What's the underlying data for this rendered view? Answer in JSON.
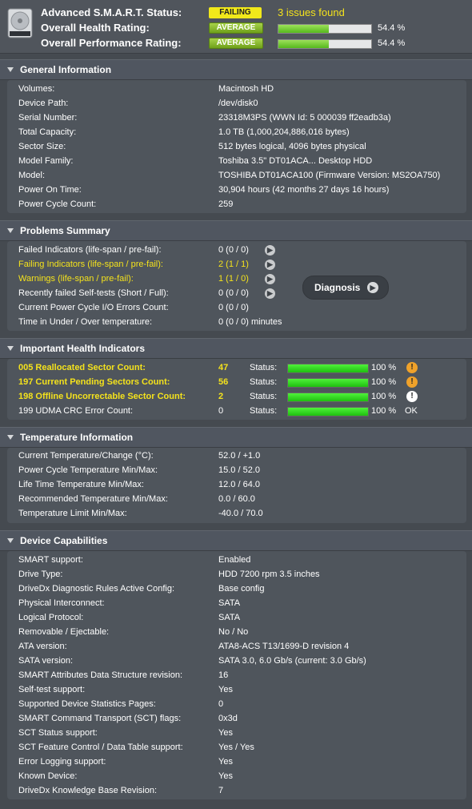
{
  "header": {
    "smart_label": "Advanced S.M.A.R.T. Status:",
    "smart_badge": "FAILING",
    "issues_text": "3 issues found",
    "health_label": "Overall Health Rating:",
    "health_badge": "AVERAGE",
    "health_pct": "54.4 %",
    "health_fraction": 0.544,
    "perf_label": "Overall Performance Rating:",
    "perf_badge": "AVERAGE",
    "perf_pct": "54.4 %",
    "perf_fraction": 0.544,
    "icon": "hard-drive-icon"
  },
  "general": {
    "title": "General Information",
    "rows": [
      {
        "label": "Volumes:",
        "value": "Macintosh HD"
      },
      {
        "label": "Device Path:",
        "value": "/dev/disk0"
      },
      {
        "label": "Serial Number:",
        "value": "23318M3PS (WWN Id: 5 000039 ff2eadb3a)"
      },
      {
        "label": "Total Capacity:",
        "value": "1.0 TB (1,000,204,886,016 bytes)"
      },
      {
        "label": "Sector Size:",
        "value": "512 bytes logical, 4096 bytes physical"
      },
      {
        "label": "Model Family:",
        "value": "Toshiba 3.5\" DT01ACA... Desktop HDD"
      },
      {
        "label": "Model:",
        "value": "TOSHIBA DT01ACA100  (Firmware Version: MS2OA750)"
      },
      {
        "label": "Power On Time:",
        "value": "30,904 hours (42 months 27 days 16 hours)"
      },
      {
        "label": "Power Cycle Count:",
        "value": "259"
      }
    ]
  },
  "problems": {
    "title": "Problems Summary",
    "rows": [
      {
        "label": "Failed Indicators (life-span / pre-fail):",
        "value": "0 (0 / 0)",
        "yellow": false,
        "arrow": true
      },
      {
        "label": "Failing Indicators (life-span / pre-fail):",
        "value": "2 (1 / 1)",
        "yellow": true,
        "arrow": true
      },
      {
        "label": "Warnings (life-span / pre-fail):",
        "value": "1 (1 / 0)",
        "yellow": true,
        "arrow": true
      },
      {
        "label": "Recently failed Self-tests (Short / Full):",
        "value": "0 (0 / 0)",
        "yellow": false,
        "arrow": true
      },
      {
        "label": "Current Power Cycle I/O Errors Count:",
        "value": "0 (0 / 0)",
        "yellow": false,
        "arrow": false
      },
      {
        "label": "Time in Under / Over temperature:",
        "value": "0 (0 / 0)   minutes",
        "yellow": false,
        "arrow": false
      }
    ],
    "diagnosis_label": "Diagnosis"
  },
  "health": {
    "title": "Important Health Indicators",
    "status_label": "Status:",
    "rows": [
      {
        "name": "005  Reallocated Sector Count:",
        "value": "47",
        "pct": "100 %",
        "fraction": 1.0,
        "flag": "!",
        "flag_type": "warning",
        "highlight": true
      },
      {
        "name": "197  Current Pending Sectors Count:",
        "value": "56",
        "pct": "100 %",
        "fraction": 1.0,
        "flag": "!",
        "flag_type": "warning",
        "highlight": true
      },
      {
        "name": "198  Offline Uncorrectable Sector Count:",
        "value": "2",
        "pct": "100 %",
        "fraction": 1.0,
        "flag": "!",
        "flag_type": "info",
        "highlight": true
      },
      {
        "name": "199  UDMA CRC Error Count:",
        "value": "0",
        "pct": "100 %",
        "fraction": 1.0,
        "flag": "OK",
        "flag_type": "ok",
        "highlight": false
      }
    ]
  },
  "temperature": {
    "title": "Temperature Information",
    "rows": [
      {
        "label": "Current Temperature/Change (°C):",
        "value": "52.0   / +1.0"
      },
      {
        "label": "Power Cycle Temperature Min/Max:",
        "value": "15.0   / 52.0"
      },
      {
        "label": "Life Time Temperature Min/Max:",
        "value": "12.0   / 64.0"
      },
      {
        "label": "Recommended Temperature Min/Max:",
        "value": "0.0     / 60.0"
      },
      {
        "label": "Temperature Limit Min/Max:",
        "value": "-40.0 / 70.0"
      }
    ]
  },
  "capabilities": {
    "title": "Device Capabilities",
    "rows": [
      {
        "label": "SMART support:",
        "value": "Enabled"
      },
      {
        "label": "Drive Type:",
        "value": "HDD 7200 rpm 3.5 inches"
      },
      {
        "label": "DriveDx Diagnostic Rules Active Config:",
        "value": "Base config"
      },
      {
        "label": "Physical Interconnect:",
        "value": "SATA"
      },
      {
        "label": "Logical Protocol:",
        "value": "SATA"
      },
      {
        "label": "Removable / Ejectable:",
        "value": "No / No"
      },
      {
        "label": "ATA version:",
        "value": "ATA8-ACS T13/1699-D revision 4"
      },
      {
        "label": "SATA version:",
        "value": "SATA 3.0, 6.0 Gb/s (current: 3.0 Gb/s)"
      },
      {
        "label": "SMART Attributes Data Structure revision:",
        "value": "16"
      },
      {
        "label": "Self-test support:",
        "value": "Yes"
      },
      {
        "label": "Supported Device Statistics Pages:",
        "value": "0"
      },
      {
        "label": "SMART Command Transport (SCT) flags:",
        "value": "0x3d"
      },
      {
        "label": "SCT Status support:",
        "value": "Yes"
      },
      {
        "label": "SCT Feature Control / Data Table support:",
        "value": "Yes / Yes"
      },
      {
        "label": "Error Logging support:",
        "value": "Yes"
      },
      {
        "label": "Known Device:",
        "value": "Yes"
      },
      {
        "label": "DriveDx Knowledge Base Revision:",
        "value": "7"
      }
    ]
  },
  "colors": {
    "background": "#454a50",
    "warning_yellow": "#f4e21c",
    "bar_green": "#2fd41c",
    "warning_orange": "#f0a22a"
  }
}
